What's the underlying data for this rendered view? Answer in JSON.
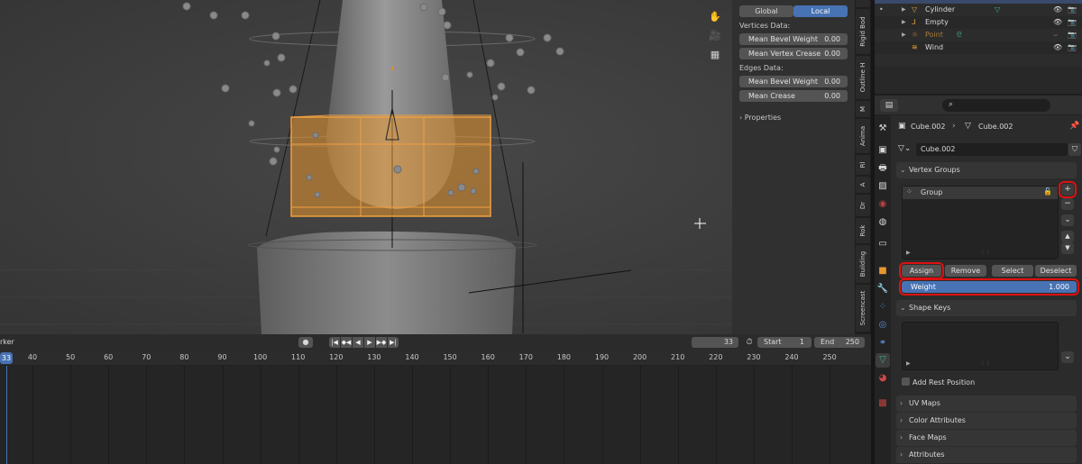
{
  "npanel": {
    "global_label": "Global",
    "local_label": "Local",
    "vertices_data_label": "Vertices Data:",
    "mean_bevel_weight_label": "Mean Bevel Weight",
    "mean_bevel_weight_value": "0.00",
    "mean_vertex_crease_label": "Mean Vertex Crease",
    "mean_vertex_crease_value": "0.00",
    "edges_data_label": "Edges Data:",
    "edge_mean_bevel_weight_label": "Mean Bevel Weight",
    "edge_mean_bevel_weight_value": "0.00",
    "mean_crease_label": "Mean Crease",
    "mean_crease_value": "0.00",
    "properties_label": "Properties"
  },
  "vertical_tabs": [
    "Rigid Bod",
    "Outline H",
    "M",
    "Anima",
    "Rl",
    "A",
    "Dr",
    "Rok",
    "Building",
    "Screencast"
  ],
  "timeline": {
    "marker_label": "rker",
    "current_frame": "33",
    "frame_field": "33",
    "start_label": "Start",
    "start_value": "1",
    "end_label": "End",
    "end_value": "250",
    "ruler_ticks": [
      "40",
      "50",
      "60",
      "70",
      "80",
      "90",
      "100",
      "110",
      "120",
      "130",
      "140",
      "150",
      "160",
      "170",
      "180",
      "190",
      "200",
      "210",
      "220",
      "230",
      "240",
      "250"
    ]
  },
  "outliner": {
    "items": [
      {
        "label": "Cylinder",
        "icon": "cone-icon",
        "color": "#e8a33c"
      },
      {
        "label": "Empty",
        "icon": "empty-axes-icon",
        "color": "#e8a33c"
      },
      {
        "label": "Point",
        "icon": "light-point-icon",
        "color": "#a87a3a"
      },
      {
        "label": "Wind",
        "icon": "force-field-icon",
        "color": "#e8a33c"
      }
    ]
  },
  "properties": {
    "breadcrumb_object": "Cube.002",
    "breadcrumb_mesh": "Cube.002",
    "mesh_name": "Cube.002",
    "vertex_groups_label": "Vertex Groups",
    "group_name": "Group",
    "assign_label": "Assign",
    "remove_label": "Remove",
    "select_label": "Select",
    "deselect_label": "Deselect",
    "weight_label": "Weight",
    "weight_value": "1.000",
    "shape_keys_label": "Shape Keys",
    "add_rest_position_label": "Add Rest Position",
    "uv_maps_label": "UV Maps",
    "color_attributes_label": "Color Attributes",
    "face_maps_label": "Face Maps",
    "attributes_label": "Attributes"
  },
  "colors": {
    "accent": "#4772b3",
    "selection_orange": "#e8962e",
    "highlight_red": "#e01010",
    "mesh_green": "#3fb37f"
  }
}
